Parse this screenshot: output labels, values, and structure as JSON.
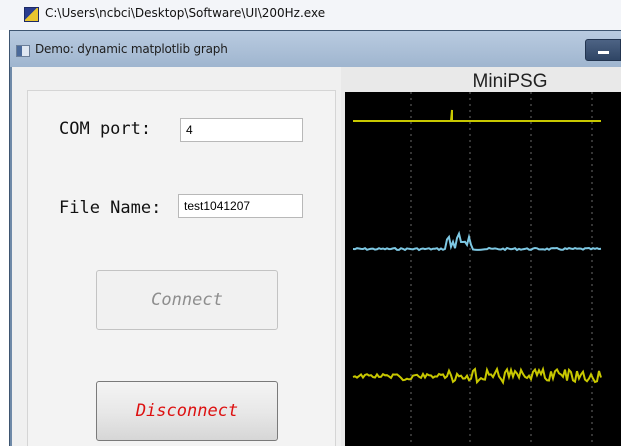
{
  "outer_window": {
    "title": "C:\\Users\\ncbci\\Desktop\\Software\\UI\\200Hz.exe"
  },
  "app_window": {
    "title": "Demo: dynamic matplotlib graph",
    "minimize_icon": "minimize-icon"
  },
  "form": {
    "com_port_label": "COM port:",
    "com_port_value": "4",
    "file_name_label": "File Name:",
    "file_name_value": "test1041207",
    "connect_label": "Connect",
    "disconnect_label": "Disconnect"
  },
  "plot": {
    "title": "MiniPSG",
    "background": "#000000",
    "grid": "dotted vertical lines",
    "channel_colors": [
      "#c8c800",
      "#7ec8e3",
      "#c8c800"
    ],
    "channel_count": 3
  }
}
